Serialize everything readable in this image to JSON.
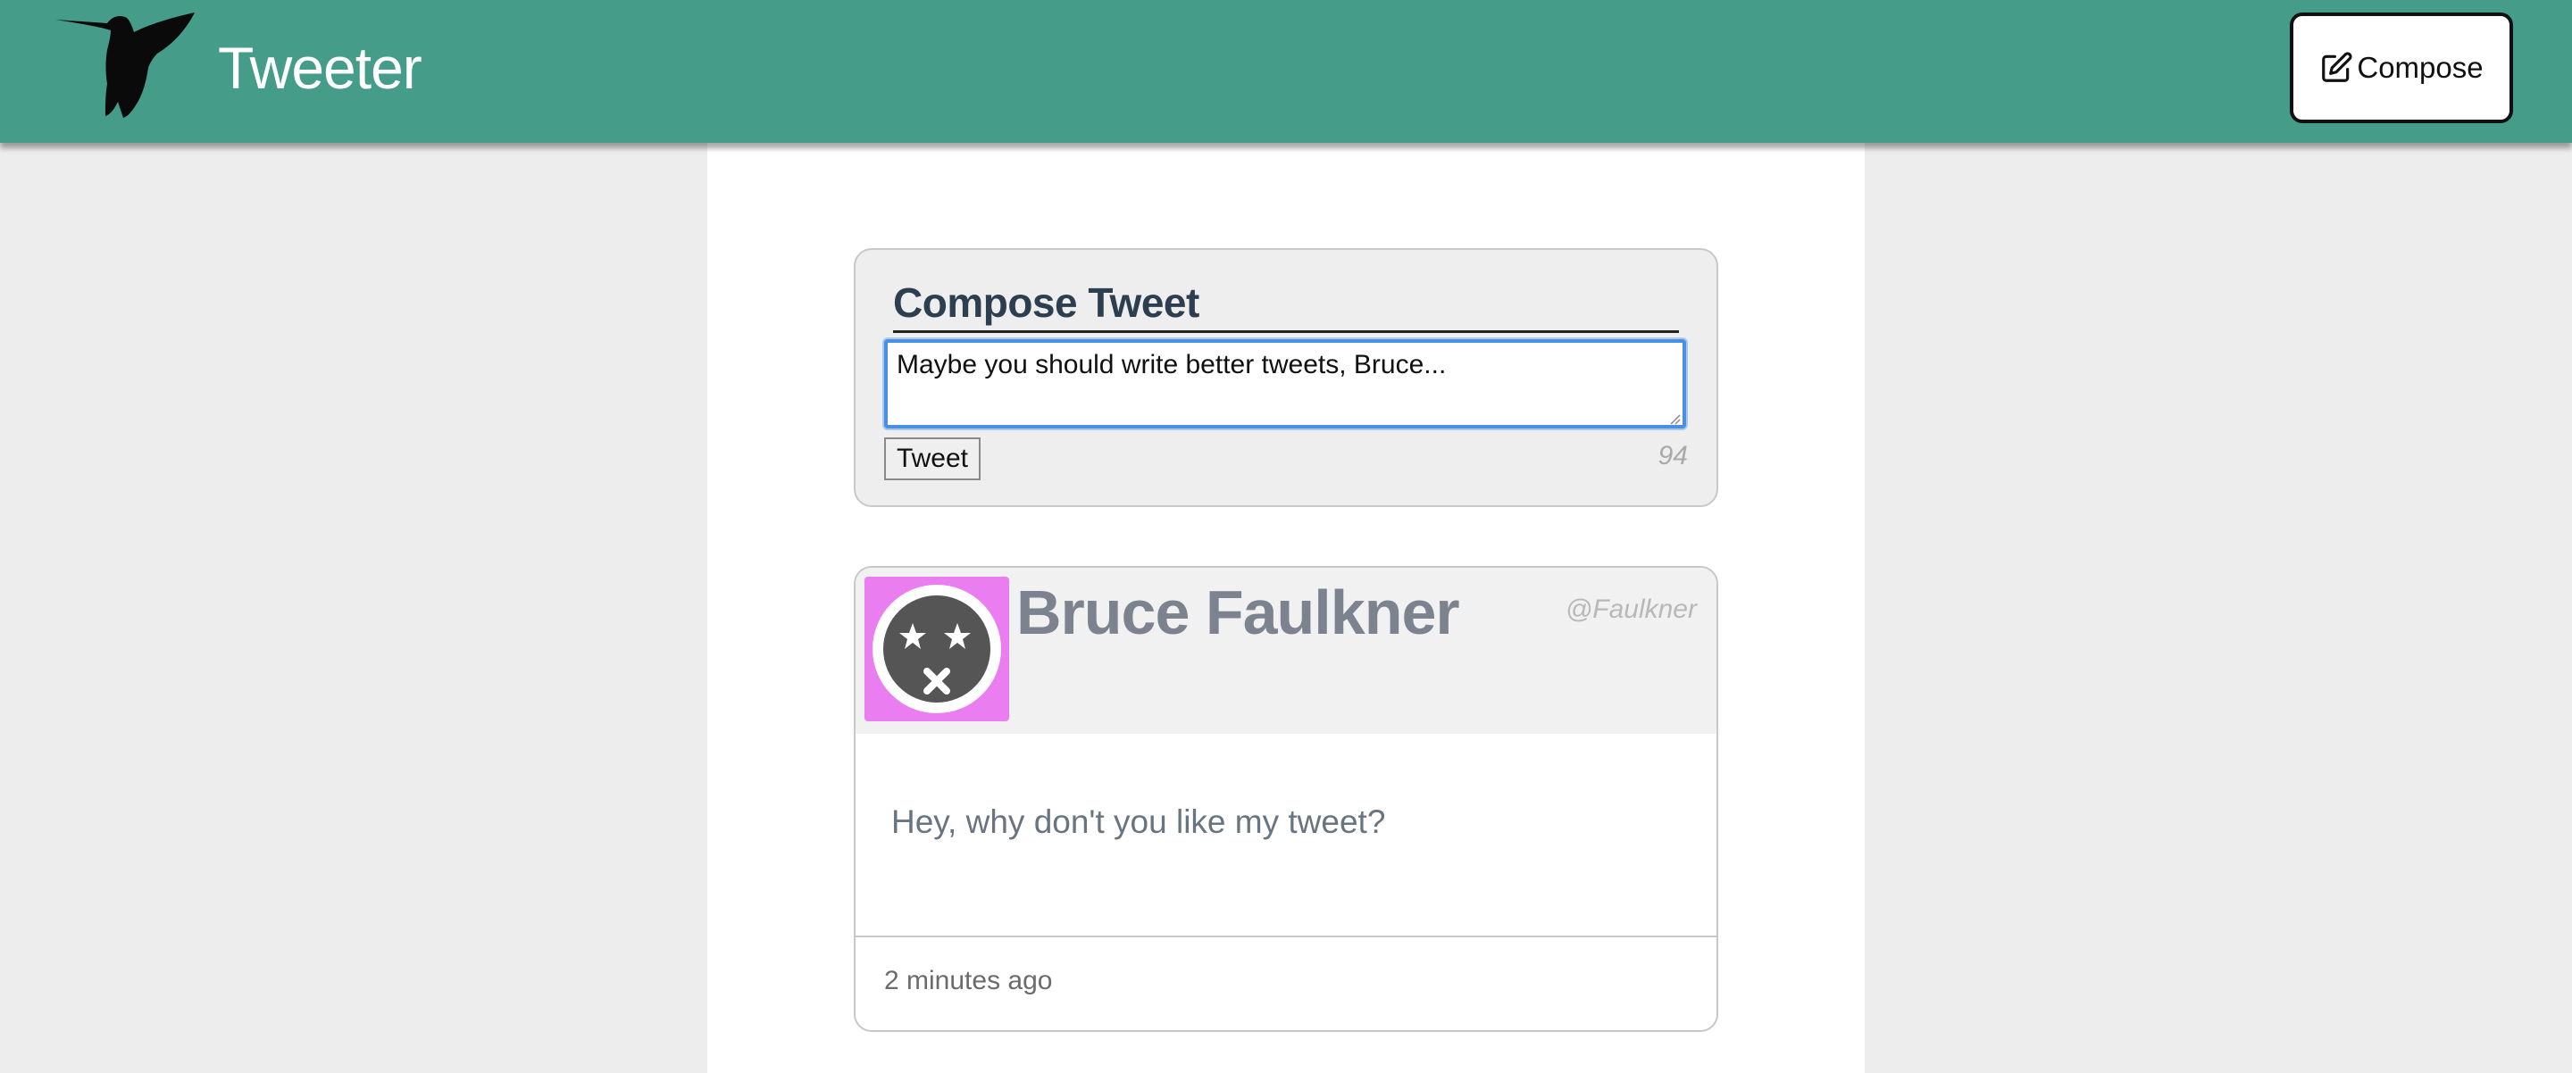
{
  "nav": {
    "brand": "Tweeter",
    "compose_label": "Compose",
    "compose_icon": "edit-icon",
    "logo_icon": "hummingbird-icon"
  },
  "new_tweet": {
    "heading": "Compose Tweet",
    "text": "Maybe you should write better tweets, Bruce...",
    "submit_label": "Tweet",
    "char_counter": "94"
  },
  "tweets": [
    {
      "name": "Bruce Faulkner",
      "handle": "@Faulkner",
      "content": "Hey, why don't you like my tweet?",
      "time": "2 minutes ago",
      "avatar_icon": "dizzy-face-icon",
      "avatar_bg": "#ea7df0"
    }
  ],
  "colors": {
    "nav_bg": "#459d89",
    "page_bg": "#ededed",
    "focus_ring": "#4a90e2"
  }
}
